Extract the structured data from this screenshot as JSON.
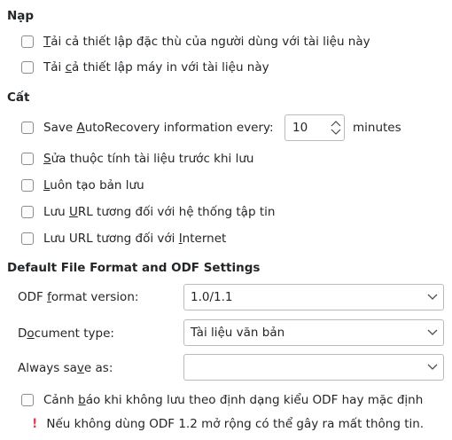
{
  "load": {
    "title": "Nạp",
    "items": [
      {
        "pre": "",
        "u": "T",
        "post": "ải cả thiết lập đặc thù của người dùng với tài liệu này"
      },
      {
        "pre": "Tải ",
        "u": "c",
        "post": "ả thiết lập máy in với tài liệu này"
      }
    ]
  },
  "save": {
    "title": "Cất",
    "autorecovery": {
      "pre": "Save ",
      "u": "A",
      "post": "utoRecovery information every:",
      "value": "10",
      "unit": "minutes"
    },
    "items": [
      {
        "pre": "",
        "u": "S",
        "post": "ửa thuộc tính tài liệu trước khi lưu"
      },
      {
        "pre": "",
        "u": "L",
        "post": "uôn tạo bản lưu"
      },
      {
        "pre": "Lưu ",
        "u": "U",
        "post": "RL tương đối với hệ thống tập tin"
      },
      {
        "pre": "Lưu URL tương đối với ",
        "u": "I",
        "post": "nternet"
      }
    ]
  },
  "format": {
    "title": "Default File Format and ODF Settings",
    "odf_version": {
      "pre": "ODF ",
      "u": "f",
      "post": "ormat version:",
      "value": "1.0/1.1"
    },
    "doc_type": {
      "pre": "D",
      "u": "o",
      "post": "cument type:",
      "value": "Tài liệu văn bản"
    },
    "always_save": {
      "pre": "Always sa",
      "u": "v",
      "post": "e as:",
      "value": ""
    },
    "warn_checkbox": {
      "pre": "Cảnh ",
      "u": "b",
      "post": "áo khi không lưu theo định dạng kiểu ODF hay mặc định"
    },
    "warning_icon": "!",
    "warning_text": "Nếu không dùng ODF 1.2 mở rộng có thể gây ra mất thông tin."
  }
}
